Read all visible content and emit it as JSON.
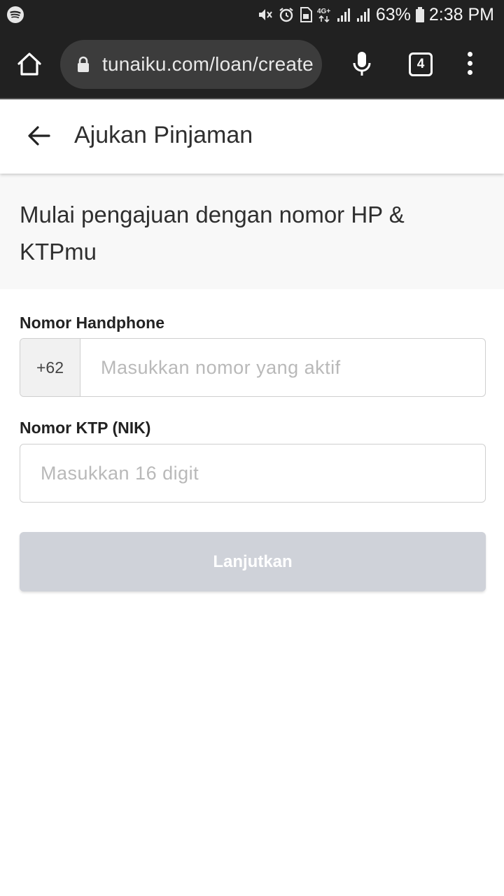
{
  "status_bar": {
    "battery": "63%",
    "time": "2:38 PM",
    "network": "4G+",
    "icons": [
      "spotify-icon",
      "mute-icon",
      "alarm-icon",
      "sim-icon",
      "network-4g-icon",
      "signal-icon",
      "signal-icon",
      "battery-icon"
    ]
  },
  "browser": {
    "url": "tunaiku.com/loan/create",
    "tab_count": "4",
    "icons": [
      "home-icon",
      "lock-icon",
      "mic-icon",
      "tabs-icon",
      "more-vert-icon"
    ]
  },
  "header": {
    "title": "Ajukan Pinjaman",
    "back_icon": "arrow-left-icon"
  },
  "intro": {
    "text": "Mulai pengajuan dengan nomor HP & KTPmu"
  },
  "form": {
    "phone": {
      "label": "Nomor Handphone",
      "prefix": "+62",
      "placeholder": "Masukkan nomor yang aktif",
      "value": ""
    },
    "nik": {
      "label": "Nomor KTP (NIK)",
      "placeholder": "Masukkan 16 digit",
      "value": ""
    },
    "submit_label": "Lanjutkan"
  },
  "colors": {
    "chrome_bg": "#212121",
    "url_bg": "#3c3c3c",
    "intro_bg": "#f8f8f8",
    "button_disabled": "#cfd2d9",
    "placeholder": "#b9b9b9"
  }
}
